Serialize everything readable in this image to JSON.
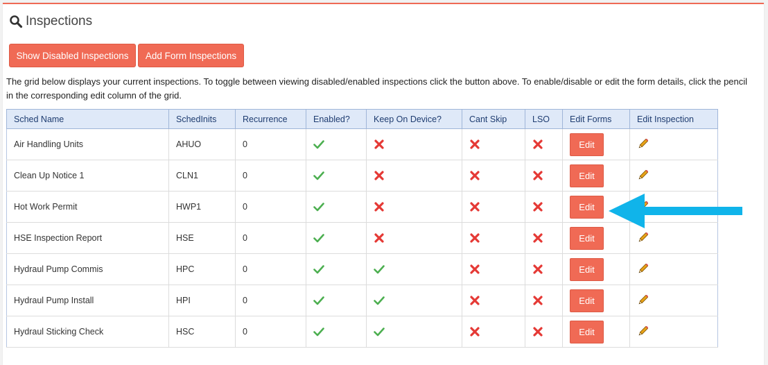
{
  "page": {
    "title": "Inspections"
  },
  "buttons": {
    "show_disabled": "Show Disabled Inspections",
    "add_form": "Add Form Inspections"
  },
  "description": "The grid below displays your current inspections. To toggle between viewing disabled/enabled inspections click the button above. To enable/disable or edit the form details, click the pencil in the corresponding edit column of the grid.",
  "grid": {
    "columns": [
      "Sched Name",
      "SchedInits",
      "Recurrence",
      "Enabled?",
      "Keep On Device?",
      "Cant Skip",
      "LSO",
      "Edit Forms",
      "Edit Inspection"
    ],
    "edit_label": "Edit",
    "rows": [
      {
        "name": "Air Handling Units",
        "inits": "AHUO",
        "recurrence": "0",
        "enabled": true,
        "keep": false,
        "cant_skip": false,
        "lso": false
      },
      {
        "name": "Clean Up Notice 1",
        "inits": "CLN1",
        "recurrence": "0",
        "enabled": true,
        "keep": false,
        "cant_skip": false,
        "lso": false
      },
      {
        "name": "Hot Work Permit",
        "inits": "HWP1",
        "recurrence": "0",
        "enabled": true,
        "keep": false,
        "cant_skip": false,
        "lso": false
      },
      {
        "name": "HSE Inspection Report",
        "inits": "HSE",
        "recurrence": "0",
        "enabled": true,
        "keep": false,
        "cant_skip": false,
        "lso": false
      },
      {
        "name": "Hydraul Pump Commis",
        "inits": "HPC",
        "recurrence": "0",
        "enabled": true,
        "keep": true,
        "cant_skip": false,
        "lso": false
      },
      {
        "name": "Hydraul Pump Install",
        "inits": "HPI",
        "recurrence": "0",
        "enabled": true,
        "keep": true,
        "cant_skip": false,
        "lso": false
      },
      {
        "name": "Hydraul Sticking Check",
        "inits": "HSC",
        "recurrence": "0",
        "enabled": true,
        "keep": true,
        "cant_skip": false,
        "lso": false
      }
    ]
  },
  "icons": {
    "title": "search-icon",
    "true": "check-icon",
    "false": "x-icon",
    "edit_inspection": "pencil-icon",
    "annotation": "arrow-left-icon"
  },
  "colors": {
    "accent": "#f06a55",
    "check": "#4caf50",
    "cross": "#e53935",
    "header_bg": "#dfe9f8",
    "arrow": "#10b4ea"
  }
}
